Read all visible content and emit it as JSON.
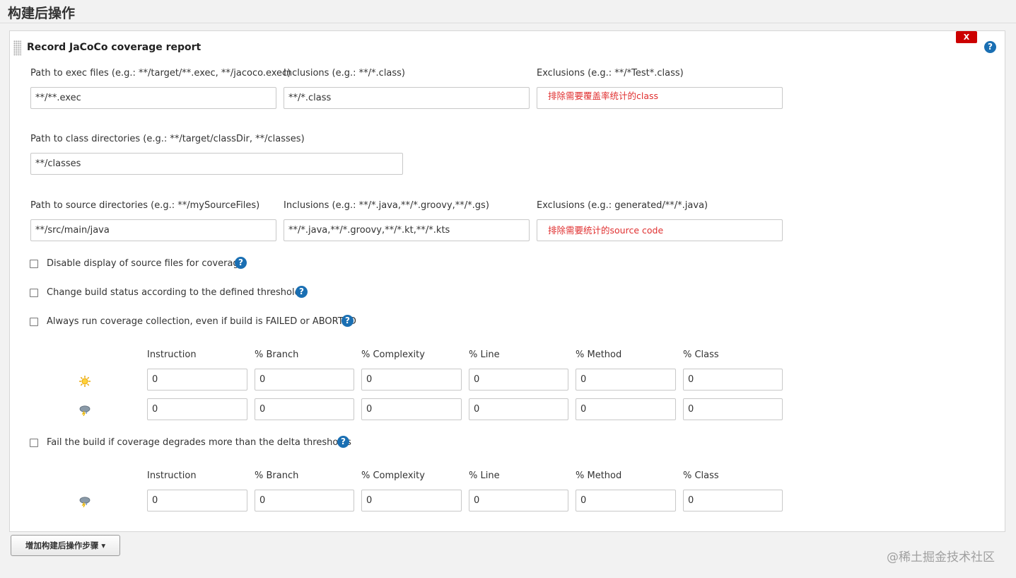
{
  "section_title": "构建后操作",
  "panel": {
    "title": "Record JaCoCo coverage report",
    "delete_label": "X",
    "help_glyph": "?"
  },
  "exec": {
    "path_label": "Path to exec files (e.g.: **/target/**.exec, **/jacoco.exec)",
    "path_value": "**/**.exec",
    "inclusions_label": "Inclusions (e.g.: **/*.class)",
    "inclusions_value": "**/*.class",
    "exclusions_label": "Exclusions (e.g.: **/*Test*.class)",
    "exclusions_value": "",
    "exclusions_annotation": "排除需要覆盖率统计的class"
  },
  "classdir": {
    "label": "Path to class directories (e.g.: **/target/classDir, **/classes)",
    "value": "**/classes"
  },
  "source": {
    "path_label": "Path to source directories (e.g.: **/mySourceFiles)",
    "path_value": "**/src/main/java",
    "inclusions_label": "Inclusions (e.g.: **/*.java,**/*.groovy,**/*.gs)",
    "inclusions_value": "**/*.java,**/*.groovy,**/*.kt,**/*.kts",
    "exclusions_label": "Exclusions (e.g.: generated/**/*.java)",
    "exclusions_value": "",
    "exclusions_annotation": "排除需要统计的source code"
  },
  "checkboxes": {
    "disable_source": {
      "label": "Disable display of source files for coverage",
      "checked": false
    },
    "change_status": {
      "label": "Change build status according to the defined thresholds",
      "checked": false
    },
    "always_run": {
      "label": "Always run coverage collection, even if build is FAILED or ABORTED",
      "checked": false
    },
    "fail_build": {
      "label": "Fail the build if coverage degrades more than the delta thresholds",
      "checked": false
    }
  },
  "threshold_columns": [
    "Instruction",
    "% Branch",
    "% Complexity",
    "% Line",
    "% Method",
    "% Class"
  ],
  "thresholds": {
    "sunny_icon": "sunny-weather-icon",
    "stormy_icon": "stormy-weather-icon",
    "sunny_values": [
      "0",
      "0",
      "0",
      "0",
      "0",
      "0"
    ],
    "stormy_values": [
      "0",
      "0",
      "0",
      "0",
      "0",
      "0"
    ]
  },
  "delta_thresholds": {
    "stormy_icon": "stormy-weather-icon",
    "values": [
      "0",
      "0",
      "0",
      "0",
      "0",
      "0"
    ]
  },
  "add_step_button": "增加构建后操作步骤",
  "add_step_caret": "▾",
  "watermark": "@稀土掘金技术社区",
  "colors": {
    "help_blue": "#1a6fb3",
    "delete_red": "#cc0000",
    "annotation_red": "#e03030"
  }
}
